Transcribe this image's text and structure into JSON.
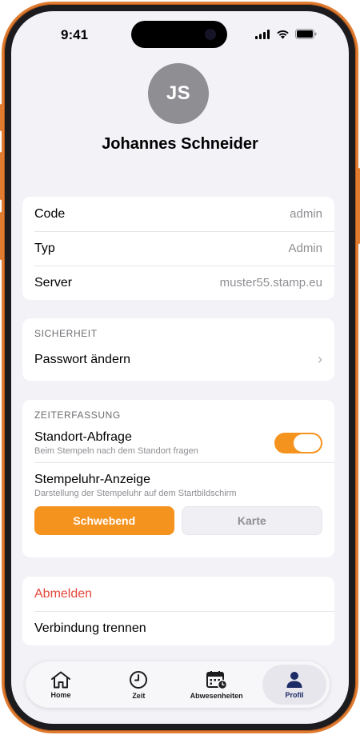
{
  "status_bar": {
    "time": "9:41"
  },
  "profile": {
    "initials": "JS",
    "name": "Johannes Schneider"
  },
  "account": {
    "rows": [
      {
        "label": "Code",
        "value": "admin"
      },
      {
        "label": "Typ",
        "value": "Admin"
      },
      {
        "label": "Server",
        "value": "muster55.stamp.eu"
      }
    ]
  },
  "security": {
    "header": "SICHERHEIT",
    "change_password": "Passwort ändern"
  },
  "time_tracking": {
    "header": "ZEITERFASSUNG",
    "location_title": "Standort-Abfrage",
    "location_subtitle": "Beim Stempeln nach dem Standort fragen",
    "location_enabled": true,
    "clock_title": "Stempeluhr-Anzeige",
    "clock_subtitle": "Darstellung der Stempeluhr auf dem Startbildschirm",
    "options": [
      "Schwebend",
      "Karte"
    ],
    "selected": "Schwebend"
  },
  "actions": {
    "logout": "Abmelden",
    "disconnect": "Verbindung trennen"
  },
  "tabbar": {
    "tabs": [
      {
        "label": "Home",
        "icon": "home-icon"
      },
      {
        "label": "Zeit",
        "icon": "clock-icon"
      },
      {
        "label": "Abwesenheiten",
        "icon": "calendar-icon"
      },
      {
        "label": "Profil",
        "icon": "person-icon"
      }
    ],
    "active": "Profil"
  },
  "colors": {
    "accent": "#f5931f",
    "destructive": "#e5473a",
    "frame": "#e07b30",
    "avatar": "#8e8e93"
  }
}
